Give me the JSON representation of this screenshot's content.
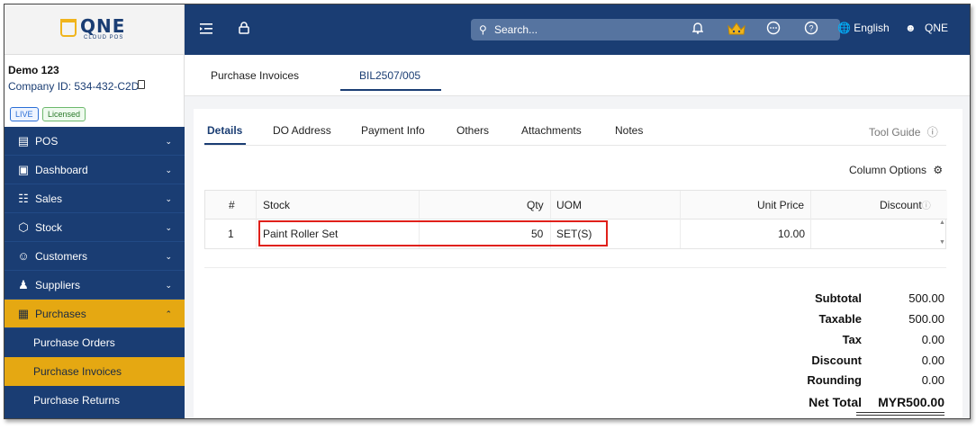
{
  "header": {
    "logo_text": "QNE",
    "logo_sub": "CLOUD POS",
    "search_placeholder": "Search...",
    "language": "English",
    "user": "QNE",
    "icons": [
      "menu-collapse-icon",
      "lock-icon",
      "bell-icon",
      "crown-icon",
      "chat-icon",
      "help-icon",
      "globe-icon",
      "user-icon"
    ]
  },
  "company": {
    "name": "Demo 123",
    "id_label": "Company ID: 534-432-C2D",
    "badge_live": "LIVE",
    "badge_licensed": "Licensed"
  },
  "sidebar": {
    "items": [
      {
        "label": "POS",
        "icon": "register-icon"
      },
      {
        "label": "Dashboard",
        "icon": "dashboard-icon"
      },
      {
        "label": "Sales",
        "icon": "sales-icon"
      },
      {
        "label": "Stock",
        "icon": "stock-icon"
      },
      {
        "label": "Customers",
        "icon": "customers-icon"
      },
      {
        "label": "Suppliers",
        "icon": "suppliers-icon"
      },
      {
        "label": "Purchases",
        "icon": "purchases-icon"
      }
    ],
    "sub_items": [
      "Purchase Orders",
      "Purchase Invoices",
      "Purchase Returns"
    ]
  },
  "tabs": {
    "top": [
      "Purchase Invoices",
      "BIL2507/005"
    ],
    "sub": [
      "Details",
      "DO Address",
      "Payment Info",
      "Others",
      "Attachments",
      "Notes"
    ],
    "tool_guide": "Tool Guide",
    "column_options": "Column Options"
  },
  "grid": {
    "headers": {
      "no": "#",
      "stock": "Stock",
      "qty": "Qty",
      "uom": "UOM",
      "price": "Unit Price",
      "discount": "Discount"
    },
    "rows": [
      {
        "no": "1",
        "stock": "Paint Roller Set",
        "qty": "50",
        "uom": "SET(S)",
        "price": "10.00",
        "discount": ""
      }
    ]
  },
  "totals": {
    "subtotal_label": "Subtotal",
    "subtotal": "500.00",
    "taxable_label": "Taxable",
    "taxable": "500.00",
    "tax_label": "Tax",
    "tax": "0.00",
    "discount_label": "Discount",
    "discount": "0.00",
    "rounding_label": "Rounding",
    "rounding": "0.00",
    "net_label": "Net Total",
    "net": "MYR500.00"
  },
  "colors": {
    "navy": "#1a3d73",
    "accent": "#e5a812",
    "highlight": "#e0201a"
  }
}
